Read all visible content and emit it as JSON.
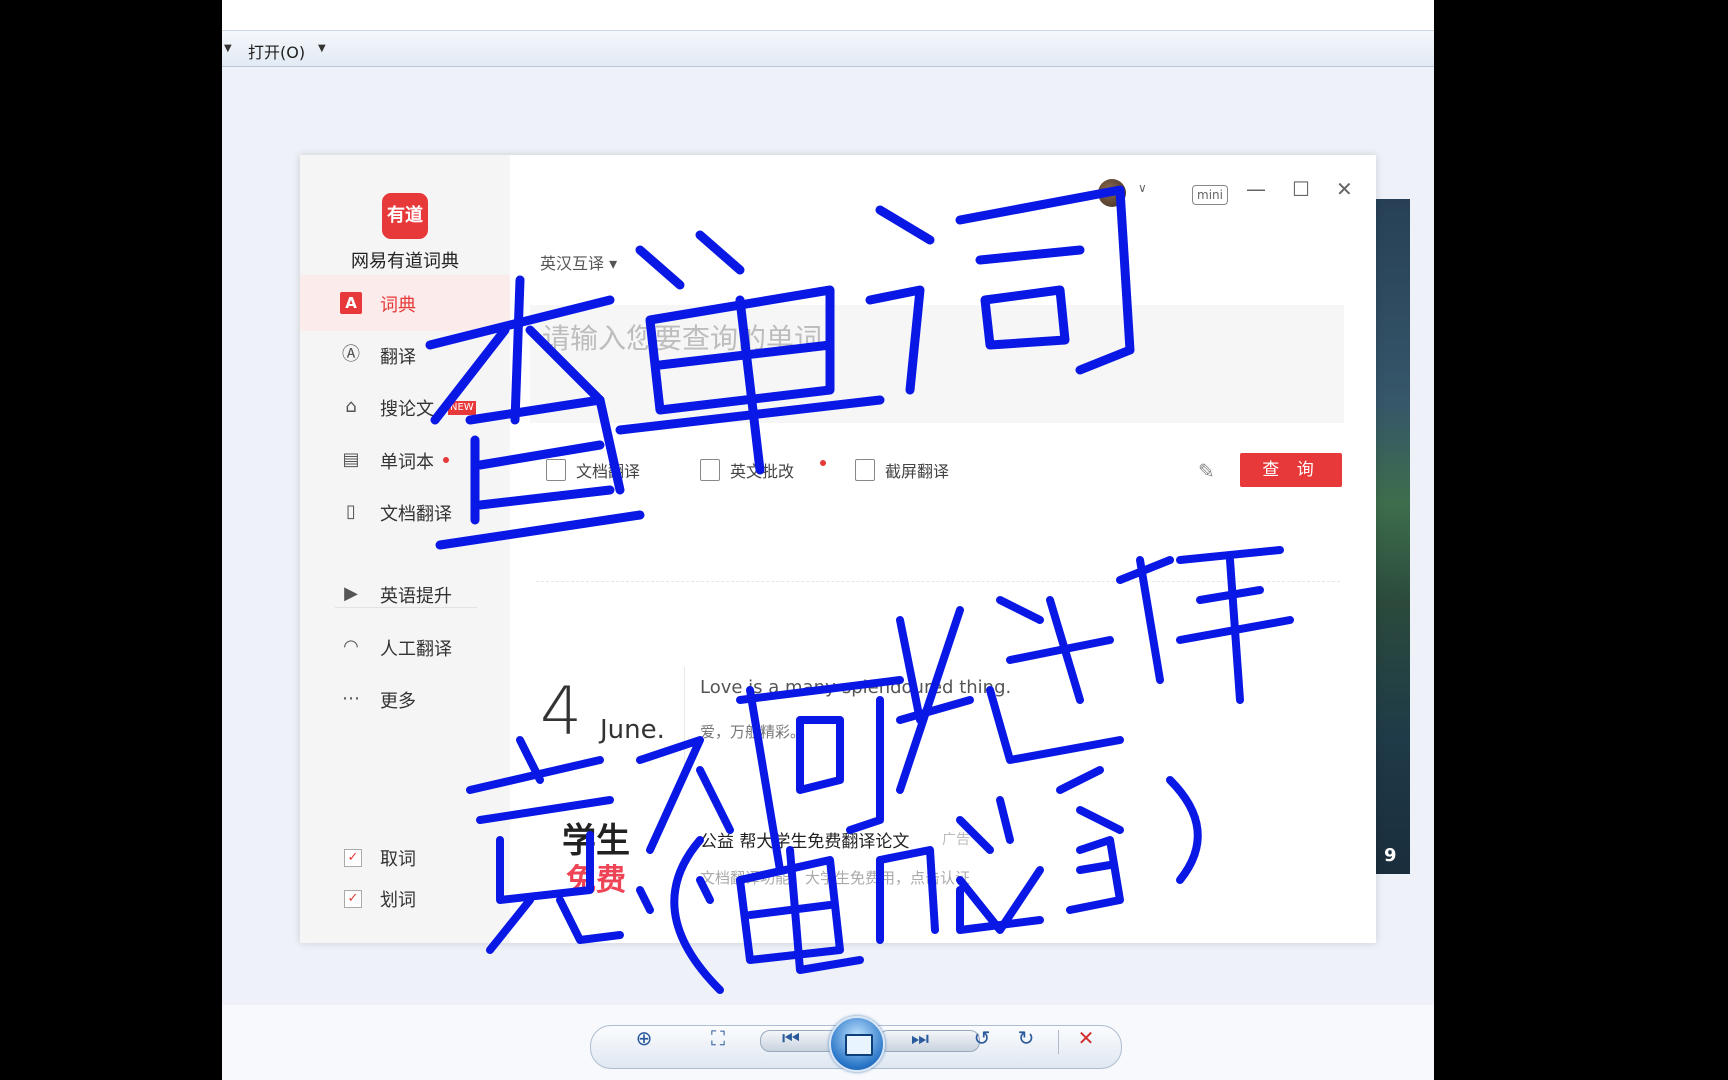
{
  "viewer": {
    "open_label": "打开(O)",
    "icons": [
      "zoom-icon",
      "fit-icon",
      "prev-icon",
      "slideshow-icon",
      "next-icon",
      "rotate-left-icon",
      "rotate-right-icon",
      "delete-icon"
    ]
  },
  "app": {
    "logo_text": "有道",
    "name": "网易有道词典",
    "brand_color": "#e7393a",
    "mini_label": "mini",
    "nav": [
      {
        "label": "词典",
        "icon": "dictionary-icon",
        "active": true
      },
      {
        "label": "翻译",
        "icon": "translate-icon"
      },
      {
        "label": "搜论文",
        "icon": "graduation-cap-icon",
        "badge": "NEW"
      },
      {
        "label": "单词本",
        "icon": "notebook-icon",
        "dot": true
      },
      {
        "label": "文档翻译",
        "icon": "document-icon"
      },
      {
        "label": "英语提升",
        "icon": "play-icon"
      },
      {
        "label": "人工翻译",
        "icon": "headset-icon"
      },
      {
        "label": "更多",
        "icon": "more-icon"
      }
    ],
    "checks": [
      {
        "label": "取词",
        "checked": true
      },
      {
        "label": "划词",
        "checked": true
      }
    ]
  },
  "main": {
    "lang_select": "英汉互译",
    "search_placeholder": "请输入您要查询的单词",
    "tools": [
      {
        "label": "文档翻译",
        "icon": "doc-translate-icon"
      },
      {
        "label": "英文批改",
        "icon": "correction-icon"
      },
      {
        "label": "截屏翻译",
        "icon": "screenshot-icon"
      }
    ],
    "search_button": "查 询",
    "daily": {
      "day": "4",
      "month": "June.",
      "quote_en": "Love is a many-splendoured thing.",
      "quote_cn": "爱，万般精彩。"
    },
    "promo": {
      "img_line1": "学生",
      "img_line2": "免费",
      "title": "公益 帮大学生免费翻译论文",
      "ad": "广告",
      "sub": "文档翻译功能，大学生免费用，点击认证"
    }
  },
  "overlay": {
    "line1": "查单词",
    "line2": "竟然可以这样",
    "line3": "（电脑篇）",
    "color": "#0a18e6"
  },
  "side_image_number": "9"
}
